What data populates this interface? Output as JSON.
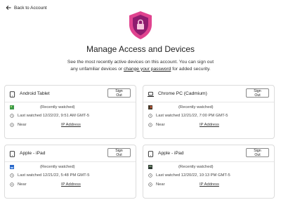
{
  "header": {
    "back_label": "Back to Account"
  },
  "main": {
    "title": "Manage Access and Devices",
    "subtitle_prefix": "See the most recently active devices on this account. You can sign out any unfamiliar devices or ",
    "subtitle_link": "change your password",
    "subtitle_suffix": " for added security."
  },
  "colors": {
    "shield_outer": "#e0438f",
    "shield_inner": "#8e1c6e",
    "thumb_green": "#3d9a4a",
    "thumb_dark": "#4a3a2a",
    "thumb_blue": "#2a67c9"
  },
  "devices": [
    {
      "name": "Android Tablet",
      "device_icon": "tablet-icon",
      "signout_label": "Sign Out",
      "recent_label": "(Recently watched)",
      "last_watched": "Last watched 12/22/22, 9:51 AM GMT-5",
      "near_label": "Near",
      "ip_label": "IP Address"
    },
    {
      "name": "Chrome PC (Cadmium)",
      "device_icon": "laptop-icon",
      "signout_label": "Sign Out",
      "recent_label": "(Recently watched)",
      "last_watched": "Last watched 12/21/22, 7:00 PM GMT-5",
      "near_label": "Near",
      "ip_label": "IP Address"
    },
    {
      "name": "Apple - iPad",
      "device_icon": "tablet-icon",
      "signout_label": "Sign Out",
      "recent_label": "(Recently watched)",
      "last_watched": "Last watched 12/21/22, 5:48 PM GMT-5",
      "near_label": "Near",
      "ip_label": "IP Address"
    },
    {
      "name": "Apple - iPad",
      "device_icon": "tablet-icon",
      "signout_label": "Sign Out",
      "recent_label": "(Recently watched)",
      "last_watched": "Last watched 12/20/22, 10:13 PM GMT-5",
      "near_label": "Near",
      "ip_label": "IP Address"
    }
  ]
}
